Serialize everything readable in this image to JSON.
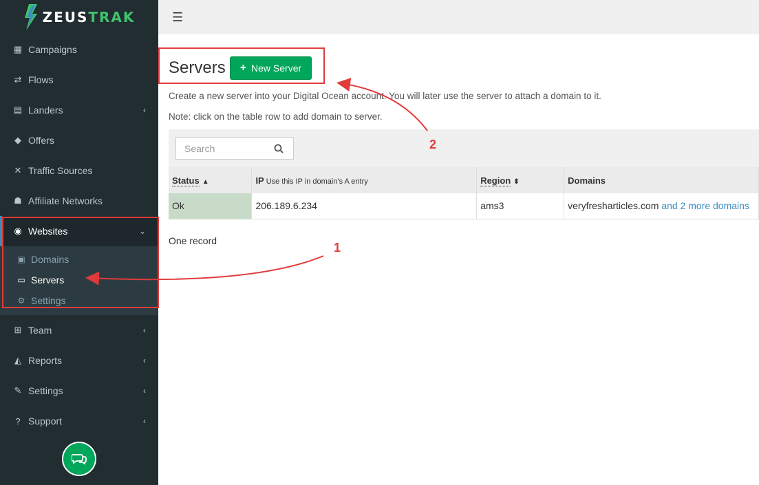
{
  "brand": {
    "part1": "ZEUS",
    "part2": "TRAK"
  },
  "sidebar": {
    "items": [
      {
        "label": "Campaigns",
        "icon": "table-icon"
      },
      {
        "label": "Flows",
        "icon": "exchange-icon"
      },
      {
        "label": "Landers",
        "icon": "list-icon"
      },
      {
        "label": "Offers",
        "icon": "tag-icon"
      },
      {
        "label": "Traffic Sources",
        "icon": "random-icon"
      },
      {
        "label": "Affiliate Networks",
        "icon": "users-icon"
      },
      {
        "label": "Websites",
        "icon": "globe-icon"
      },
      {
        "label": "Team",
        "icon": "sitemap-icon"
      },
      {
        "label": "Reports",
        "icon": "area-chart-icon"
      },
      {
        "label": "Settings",
        "icon": "wrench-icon"
      },
      {
        "label": "Support",
        "icon": "question-circle-icon"
      }
    ],
    "websites_sub": [
      {
        "label": "Domains",
        "icon": "html5-icon"
      },
      {
        "label": "Servers",
        "icon": "desktop-icon"
      },
      {
        "label": "Settings",
        "icon": "cogs-icon"
      }
    ]
  },
  "main": {
    "title": "Servers",
    "new_button": "New Server",
    "description": "Create a new server into your Digital Ocean account. You will later use the server to attach a domain to it.",
    "note": "Note: click on the table row to add domain to server.",
    "search_placeholder": "Search",
    "table": {
      "headers": {
        "status": "Status",
        "ip": "IP",
        "ip_hint": "Use this IP in domain's A entry",
        "region": "Region",
        "domains": "Domains"
      },
      "rows": [
        {
          "status": "Ok",
          "ip": "206.189.6.234",
          "region": "ams3",
          "domain": "veryfresharticles.com",
          "more": "and 2 more domains"
        }
      ]
    },
    "record_count": "One record"
  },
  "annotations": {
    "one": "1",
    "two": "2"
  },
  "colors": {
    "sidebar_bg": "#222d32",
    "accent_green": "#00a65a",
    "link_blue": "#3c8dbc",
    "annotation_red": "#e03b3b"
  }
}
